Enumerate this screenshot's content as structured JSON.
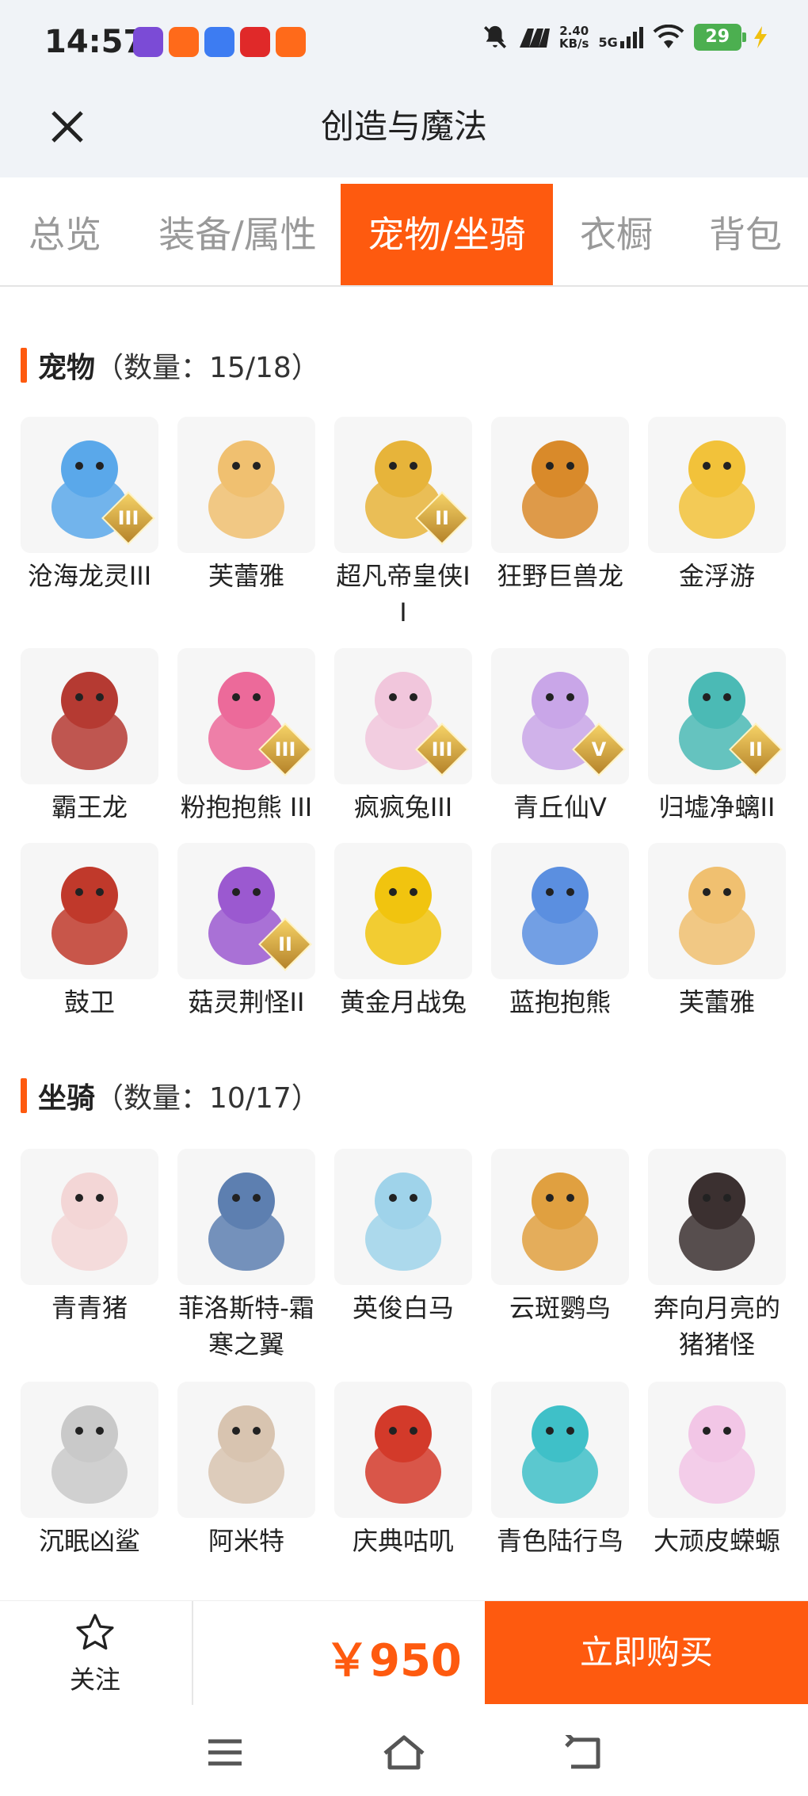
{
  "status": {
    "time": "14:57",
    "speed_value": "2.40",
    "speed_unit": "KB/s",
    "network": "5G",
    "battery": "29",
    "app_icons": [
      {
        "name": "fox-app-icon",
        "color": "#7b4bd6"
      },
      {
        "name": "grid-app-icon",
        "color": "#ff6a1a"
      },
      {
        "name": "camera-app-icon",
        "color": "#3d7cf2"
      },
      {
        "name": "shop-app-icon",
        "color": "#e02929"
      },
      {
        "name": "game-app-icon",
        "color": "#ff6a1a"
      }
    ]
  },
  "header": {
    "title": "创造与魔法"
  },
  "tabs": [
    "总览",
    "装备/属性",
    "宠物/坐骑",
    "衣橱",
    "背包"
  ],
  "active_tab": "宠物/坐骑",
  "pets": {
    "title": "宠物",
    "count": "（数量：15/18）",
    "items": [
      {
        "name": "沧海龙灵III",
        "badge": "III",
        "color": "#5aa8ea"
      },
      {
        "name": "芙蕾雅",
        "badge": "",
        "color": "#f0c070"
      },
      {
        "name": "超凡帝皇侠II",
        "badge": "II",
        "color": "#e7b43a"
      },
      {
        "name": "狂野巨兽龙",
        "badge": "",
        "color": "#d98a2a"
      },
      {
        "name": "金浮游",
        "badge": "",
        "color": "#f2c23a"
      },
      {
        "name": "霸王龙",
        "badge": "",
        "color": "#b53a32"
      },
      {
        "name": "粉抱抱熊 III",
        "badge": "III",
        "color": "#ec6a9a"
      },
      {
        "name": "疯疯兔III",
        "badge": "III",
        "color": "#f1c6dc"
      },
      {
        "name": "青丘仙V",
        "badge": "V",
        "color": "#c9a6e8"
      },
      {
        "name": "归墟净螭II",
        "badge": "II",
        "color": "#4bbab5"
      },
      {
        "name": "鼓卫",
        "badge": "",
        "color": "#c0392b"
      },
      {
        "name": "菇灵荆怪II",
        "badge": "II",
        "color": "#9b59d0"
      },
      {
        "name": "黄金月战兔",
        "badge": "",
        "color": "#f1c40f"
      },
      {
        "name": "蓝抱抱熊",
        "badge": "",
        "color": "#5b8fe0"
      },
      {
        "name": "芙蕾雅",
        "badge": "",
        "color": "#f0c070"
      }
    ]
  },
  "mounts": {
    "title": "坐骑",
    "count": "（数量：10/17）",
    "items": [
      {
        "name": "青青猪",
        "color": "#f3d6d6"
      },
      {
        "name": "菲洛斯特-霜寒之翼",
        "color": "#5d7fb0"
      },
      {
        "name": "英俊白马",
        "color": "#9fd3ea"
      },
      {
        "name": "云斑鹦鸟",
        "color": "#e0a040"
      },
      {
        "name": "奔向月亮的猪猪怪",
        "color": "#3b3030"
      },
      {
        "name": "沉眠凶鲨",
        "color": "#c9c9c9"
      },
      {
        "name": "阿米特",
        "color": "#d8c4b0"
      },
      {
        "name": "庆典咕叽",
        "color": "#d33a2a"
      },
      {
        "name": "青色陆行鸟",
        "color": "#3fc0c8"
      },
      {
        "name": "大顽皮蝾螈",
        "color": "#f2c6e6"
      }
    ]
  },
  "footer": {
    "follow_label": "关注",
    "price": "￥950",
    "buy_label": "立即购买"
  },
  "accent": "#fe5a0f"
}
